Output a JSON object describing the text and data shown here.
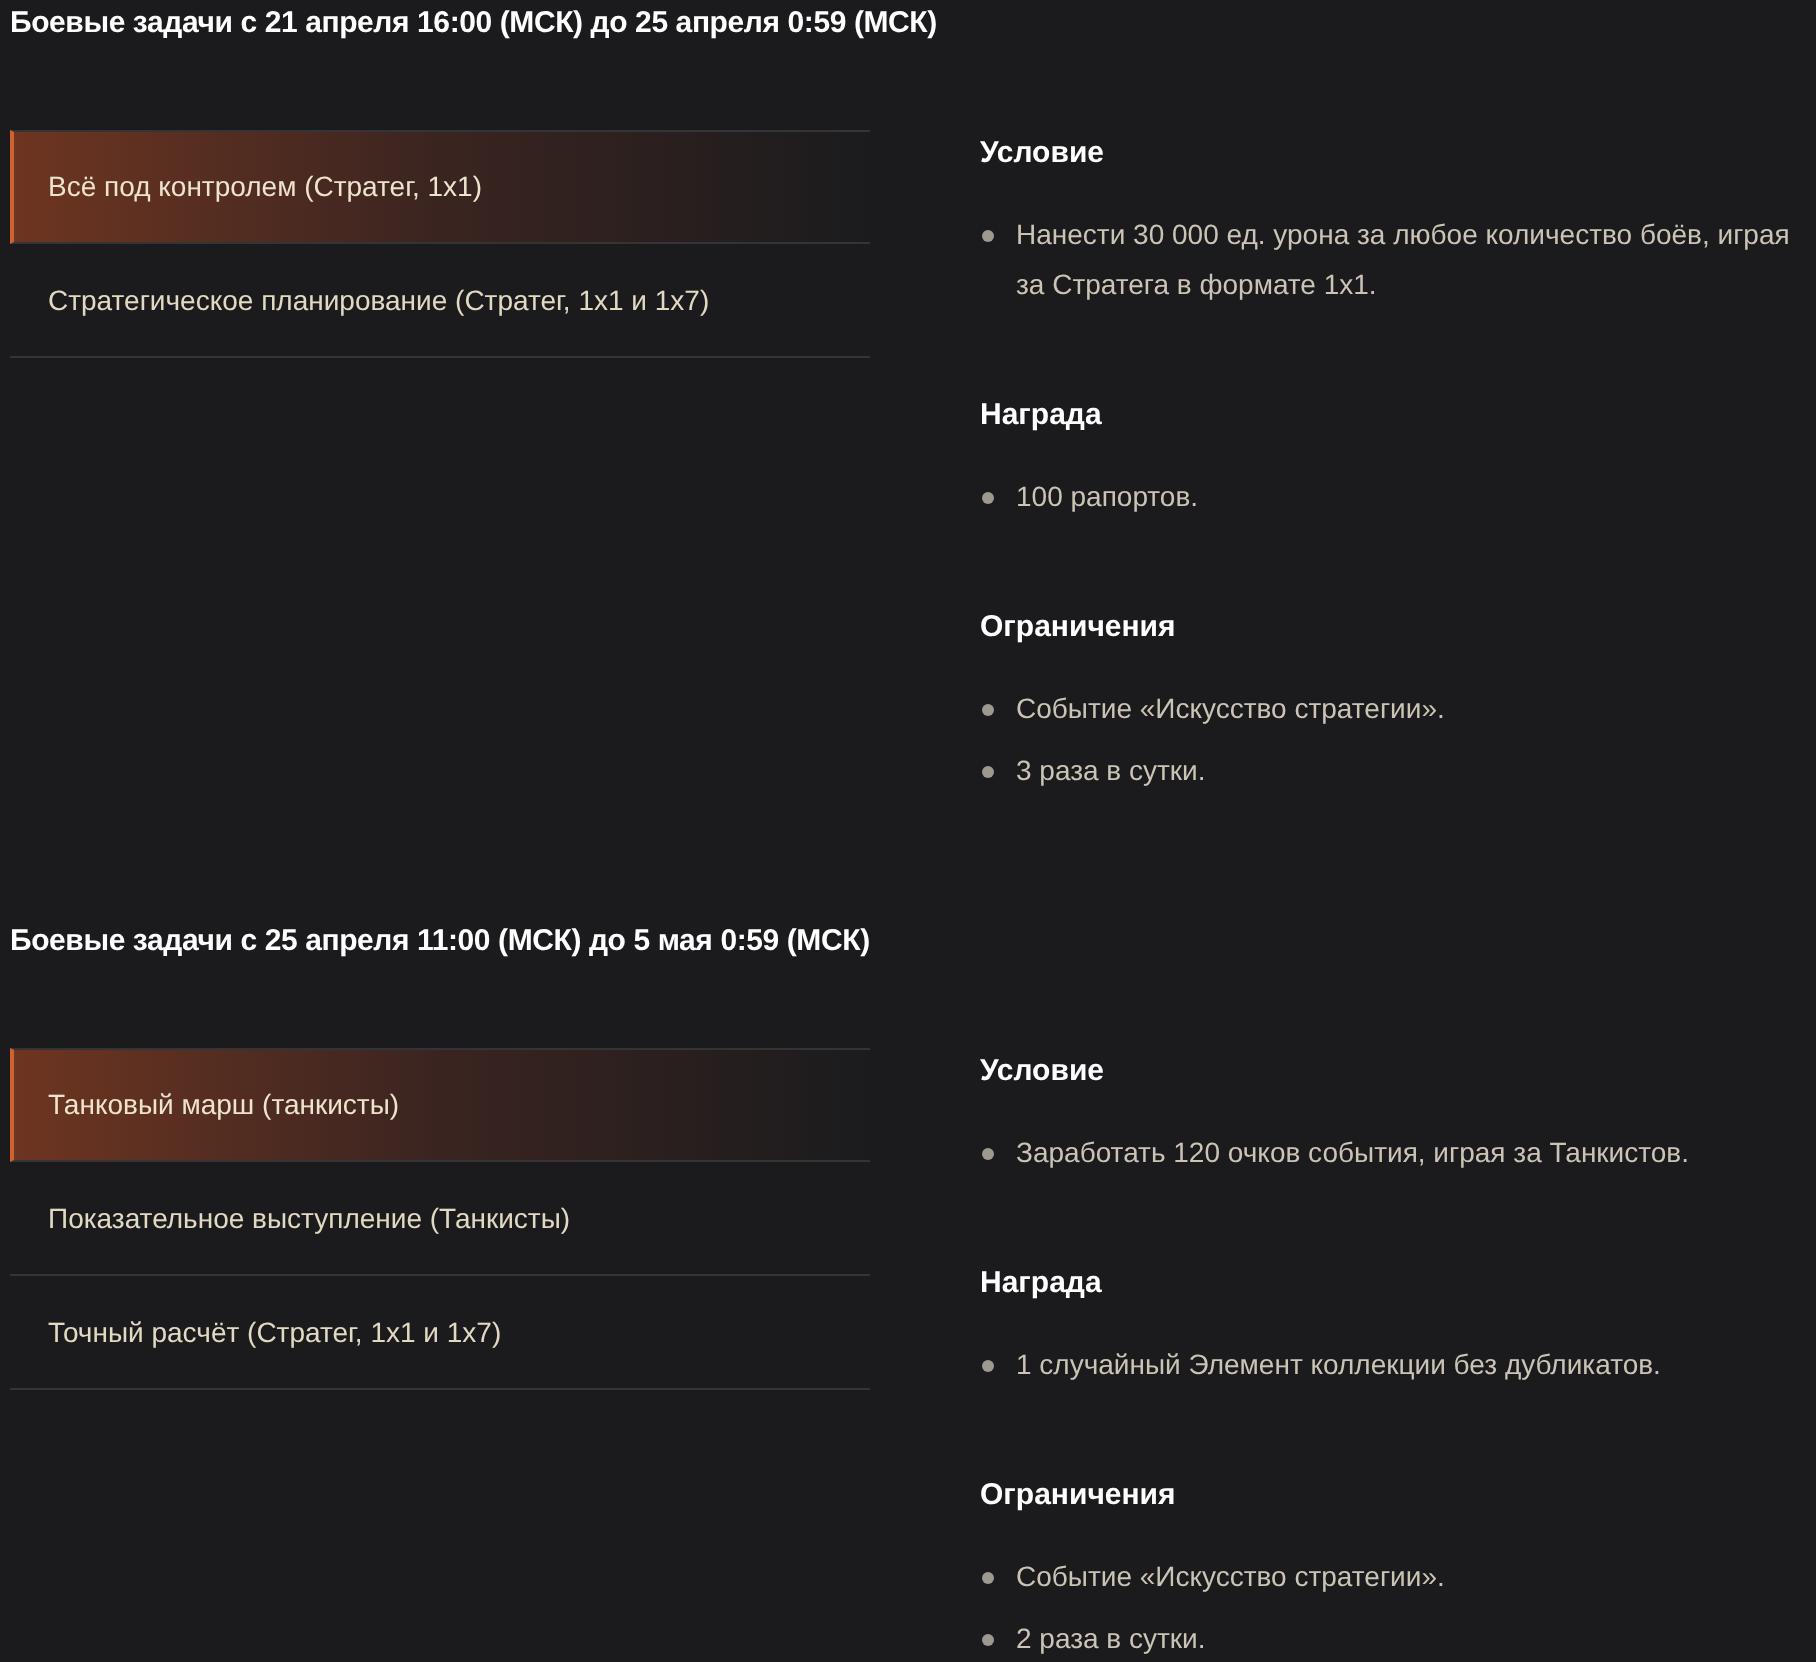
{
  "sections": [
    {
      "title": "Боевые задачи с 21 апреля 16:00 (МСК) до 25 апреля 0:59 (МСК)",
      "tasks": [
        {
          "label": "Всё под контролем (Стратег, 1х1)",
          "selected": true
        },
        {
          "label": "Стратегическое планирование (Стратег, 1х1 и 1х7)",
          "selected": false
        }
      ],
      "details": [
        {
          "heading": "Условие",
          "items": [
            "Нанести 30 000 ед. урона за любое количество боёв, играя за Стратега в формате 1х1."
          ]
        },
        {
          "heading": "Награда",
          "items": [
            "100 рапортов."
          ]
        },
        {
          "heading": "Ограничения",
          "items": [
            "Событие «Искусство стратегии».",
            "3 раза в сутки."
          ]
        }
      ]
    },
    {
      "title": "Боевые задачи с 25 апреля 11:00 (МСК) до 5 мая 0:59 (МСК)",
      "tasks": [
        {
          "label": "Танковый марш (танкисты)",
          "selected": true
        },
        {
          "label": "Показательное выступление (Танкисты)",
          "selected": false
        },
        {
          "label": "Точный расчёт (Стратег, 1х1 и 1х7)",
          "selected": false
        }
      ],
      "details": [
        {
          "heading": "Условие",
          "items": [
            "Заработать 120 очков события, играя за Танкистов."
          ]
        },
        {
          "heading": "Награда",
          "items": [
            "1 случайный Элемент коллекции без дубликатов."
          ]
        },
        {
          "heading": "Ограничения",
          "items": [
            "Событие «Искусство стратегии».",
            "2 раза в сутки."
          ]
        }
      ]
    }
  ]
}
